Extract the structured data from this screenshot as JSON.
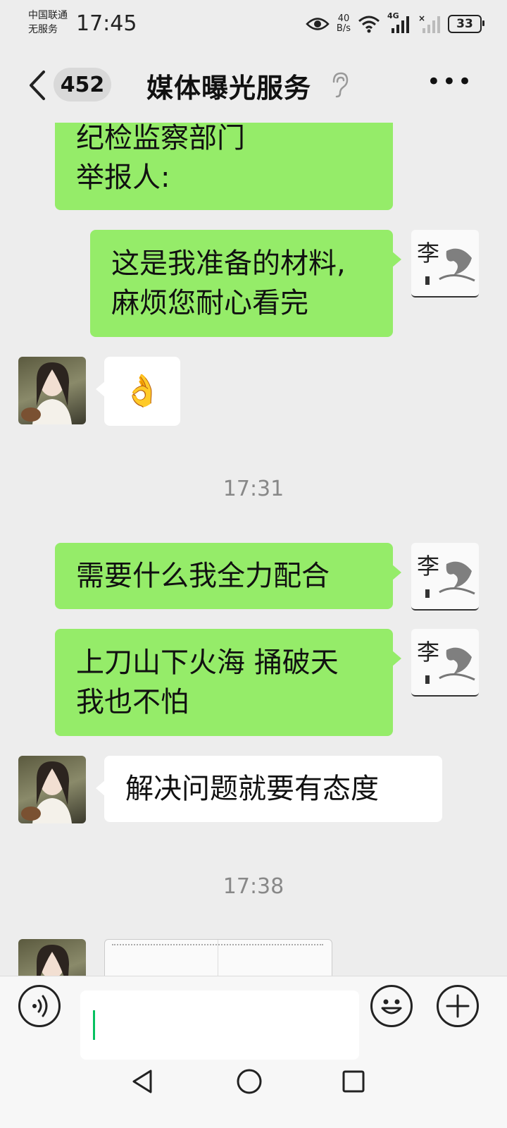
{
  "status_bar": {
    "carrier_line1": "中国联通",
    "carrier_line2": "无服务",
    "time": "17:45",
    "speed_value": "40",
    "speed_unit": "B/s",
    "network": "4G",
    "battery": "33"
  },
  "header": {
    "unread_count": "452",
    "title": "媒体曝光服务"
  },
  "messages": [
    {
      "side": "self",
      "lines": [
        "纪检监察部门",
        "举报人:"
      ]
    },
    {
      "side": "self",
      "lines": [
        "这是我准备的材料,",
        "麻烦您耐心看完"
      ]
    },
    {
      "side": "other",
      "emoji": "👌"
    },
    {
      "type": "timestamp",
      "text": "17:31"
    },
    {
      "side": "self",
      "lines": [
        "需要什么我全力配合"
      ]
    },
    {
      "side": "self",
      "lines": [
        "上刀山下火海 捅破天",
        "我也不怕"
      ]
    },
    {
      "side": "other",
      "lines": [
        "解决问题就要有态度"
      ]
    },
    {
      "type": "timestamp",
      "text": "17:38"
    }
  ],
  "avatar_self_glyph": "李",
  "icons": {
    "back": "chevron-left-icon",
    "ear": "ear-icon",
    "more": "more-icon",
    "voice": "voice-icon",
    "emoji": "emoji-icon",
    "add": "plus-icon",
    "nav_back": "triangle-back-icon",
    "nav_home": "circle-home-icon",
    "nav_recent": "square-recent-icon"
  },
  "colors": {
    "bubble_self": "#95ec69",
    "bubble_other": "#ffffff",
    "background": "#ededed",
    "caret": "#07c160"
  }
}
